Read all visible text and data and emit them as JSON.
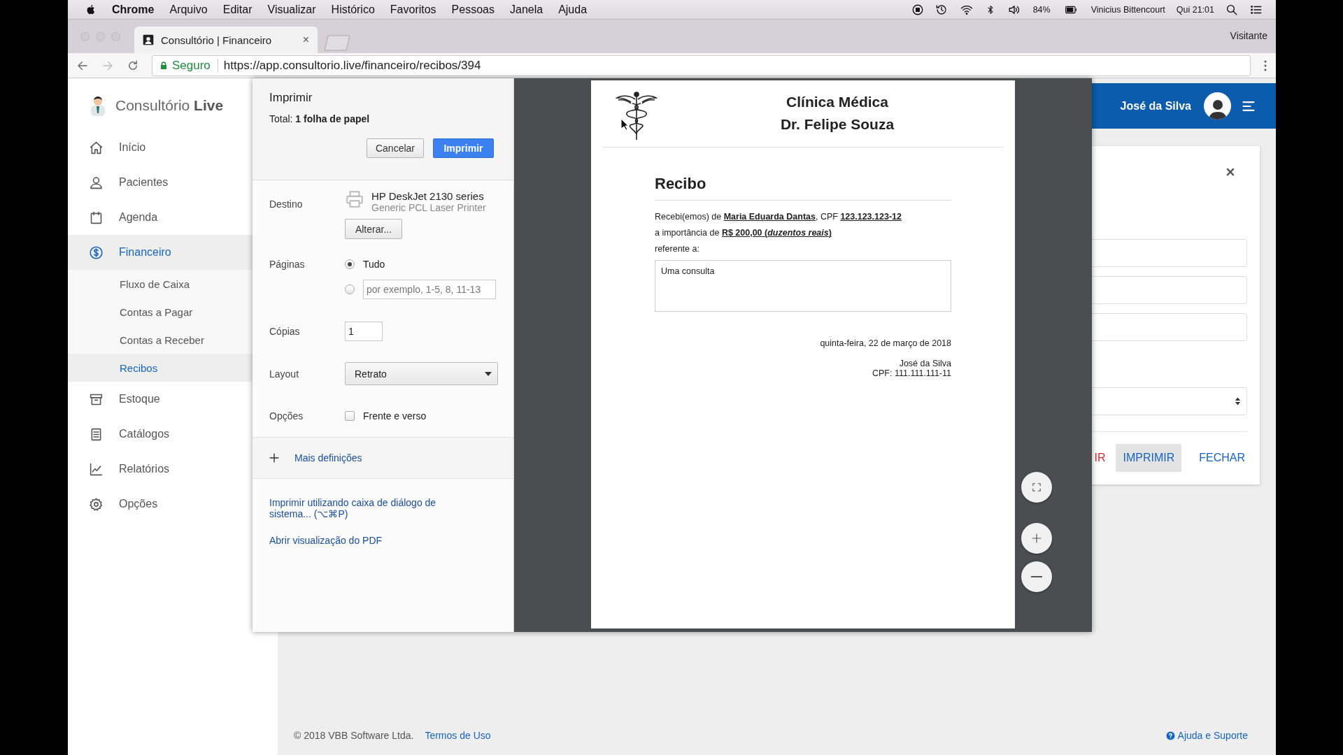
{
  "menu_bar": {
    "app": "Chrome",
    "menus": [
      "Arquivo",
      "Editar",
      "Visualizar",
      "Histórico",
      "Favoritos",
      "Pessoas",
      "Janela",
      "Ajuda"
    ],
    "battery": "84%",
    "user": "Vinicius Bittencourt",
    "clock": "Qui 21:01"
  },
  "browser": {
    "tab_title": "Consultório | Financeiro",
    "tab_close": "×",
    "profile": "Visitante",
    "security": "Seguro",
    "url": "https://app.consultorio.live/financeiro/recibos/394"
  },
  "sidebar": {
    "logo": "Consultório **Live**",
    "items": [
      {
        "label": "Início",
        "selected": false
      },
      {
        "label": "Pacientes",
        "selected": false
      },
      {
        "label": "Agenda",
        "selected": false
      },
      {
        "label": "Financeiro",
        "selected": true,
        "children": [
          {
            "label": "Fluxo de Caixa",
            "selected": false
          },
          {
            "label": "Contas a Pagar",
            "selected": false
          },
          {
            "label": "Contas a Receber",
            "selected": false
          },
          {
            "label": "Recibos",
            "selected": true
          }
        ]
      },
      {
        "label": "Estoque",
        "selected": false
      },
      {
        "label": "Catálogos",
        "selected": false
      },
      {
        "label": "Relatórios",
        "selected": false
      },
      {
        "label": "Opções",
        "selected": false
      }
    ]
  },
  "header": {
    "user": "José da Silva"
  },
  "dialog": {
    "fields": [
      {
        "kind": "text"
      },
      {
        "kind": "text"
      },
      {
        "kind": "text"
      },
      {
        "kind": "select"
      }
    ],
    "buttons": [
      {
        "label": "IR",
        "kind": "danger",
        "focused": false
      },
      {
        "label": "IMPRIMIR",
        "kind": "primary",
        "focused": true
      },
      {
        "label": "FECHAR",
        "kind": "primary",
        "focused": false
      }
    ]
  },
  "footer": {
    "copyright": "© 2018 VBB Software Ltda.",
    "terms": "Termos de Uso",
    "help": "Ajuda e Suporte"
  },
  "print": {
    "title": "Imprimir",
    "total": "Total: **1 folha de papel**",
    "cancel": "Cancelar",
    "confirm": "Imprimir",
    "destination_label": "Destino",
    "printer_name": "HP DeskJet 2130 series",
    "printer_driver": "Generic PCL Laser Printer",
    "change": "Alterar...",
    "pages_label": "Páginas",
    "pages": [
      {
        "kind": "all",
        "label": "Tudo",
        "selected": true
      },
      {
        "kind": "range",
        "placeholder": "por exemplo, 1-5, 8, 11-13",
        "selected": false
      }
    ],
    "copies_label": "Cópias",
    "copies": "1",
    "layout_label": "Layout",
    "layout": "Retrato",
    "options_label": "Opções",
    "duplex": {
      "label": "Frente e verso",
      "checked": false
    },
    "more": "Mais definições",
    "system_dialog": "Imprimir utilizando caixa de diálogo de sistema... (⌥⌘P)",
    "open_pdf": "Abrir visualização do PDF"
  },
  "receipt": {
    "clinic": "Clínica Médica",
    "doctor": "Dr. Felipe Souza",
    "title": "Recibo",
    "lines": [
      "Recebi(emos) de **Maria Eduarda Dantas**, CPF **123.123.123-12**",
      "a importância de **R$ 200,00 (*duzentos reais*)**",
      "referente a:"
    ],
    "description": "Uma consulta",
    "date": "quinta-feira, 22 de março de 2018",
    "signer": "José da Silva",
    "signer_cpf": "CPF: 111.111.111-11"
  }
}
